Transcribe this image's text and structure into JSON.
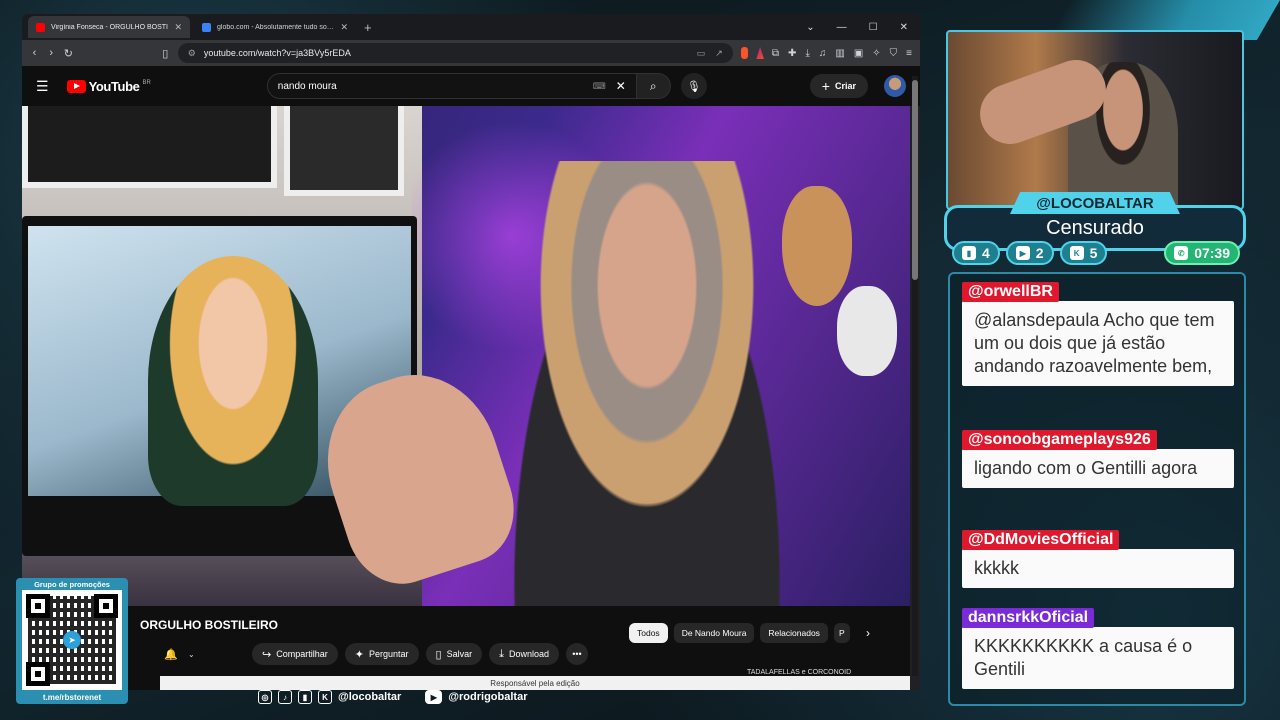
{
  "browser": {
    "tabs": [
      {
        "title": "Virgínia Fonseca - ORGULHO BOSTI",
        "favicon_color": "#ff0000",
        "active": true
      },
      {
        "title": "globo.com - Absolutamente tudo sobre not",
        "favicon_color": "#3b82f6",
        "active": false
      }
    ],
    "url": "youtube.com/watch?v=ja3BVy5rEDA"
  },
  "youtube": {
    "logo_text": "YouTube",
    "country_code": "BR",
    "search_value": "nando moura",
    "create_label": "Criar",
    "video_title": "ORGULHO BOSTILEIRO",
    "actions": {
      "share": "Compartilhar",
      "ask": "Perguntar",
      "save": "Salvar",
      "download": "Download"
    },
    "chips": [
      "Todos",
      "De Nando Moura",
      "Relacionados",
      "P"
    ],
    "next_video_title": "TADALAFELLAS e CORCONOID",
    "footer_text": "Responsável pela edição"
  },
  "overlay": {
    "qr_label": "Grupo de promoções",
    "qr_url": "t.me/rbstorenet",
    "socials": [
      "@locobaltar",
      "@rodrigobaltar"
    ],
    "streamer_tag": "@LOCOBALTAR",
    "status": "Censurado",
    "stats": [
      {
        "icon": "twitch-icon",
        "value": "4"
      },
      {
        "icon": "youtube-icon",
        "value": "2"
      },
      {
        "icon": "kick-icon",
        "value": "5"
      }
    ],
    "timer": "07:39"
  },
  "chat": [
    {
      "user": "@orwellBR",
      "color": "#e0182d",
      "text": "@alansdepaula Acho que tem um ou dois que já estão andando razoavelmente bem,"
    },
    {
      "user": "@sonoobgameplays926",
      "color": "#e0182d",
      "text": "ligando com o Gentilli agora"
    },
    {
      "user": "@DdMoviesOfficial",
      "color": "#e0182d",
      "text": "kkkkk"
    },
    {
      "user": "dannsrkkOficial",
      "color": "#7a2ad6",
      "text": "KKKKKKKKKK a causa é o Gentili"
    }
  ]
}
